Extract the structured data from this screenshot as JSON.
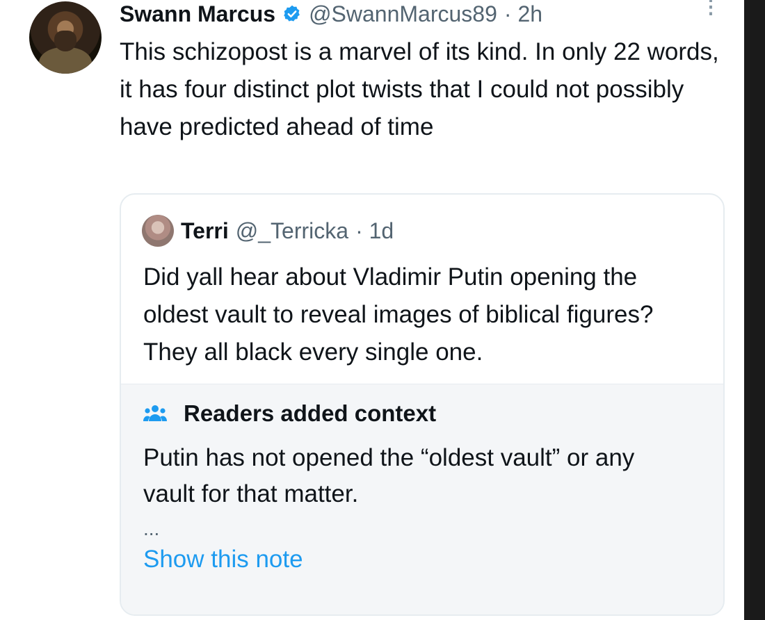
{
  "tweet": {
    "display_name": "Swann Marcus",
    "handle": "@SwannMarcus89",
    "time": "· 2h",
    "text": "This schizopost is a marvel of its kind. In only 22 words, it has four distinct plot twists that I could not possibly have predicted ahead of time",
    "more_icon": "more-vertical-icon",
    "verified_icon": "verified-badge-icon",
    "verified_color": "#1d9bf0"
  },
  "quote": {
    "display_name": "Terri",
    "handle": "@_Terricka",
    "time": "· 1d",
    "text": "Did yall hear about Vladimir  Putin opening the oldest vault to reveal images of biblical figures? They all black every single one."
  },
  "community_note": {
    "icon": "people-icon",
    "title": "Readers added context",
    "text": "Putin has not opened the “oldest vault” or any vault for that matter.",
    "ellipsis": "...",
    "link_label": "Show this note",
    "link_color": "#1d9bf0"
  }
}
